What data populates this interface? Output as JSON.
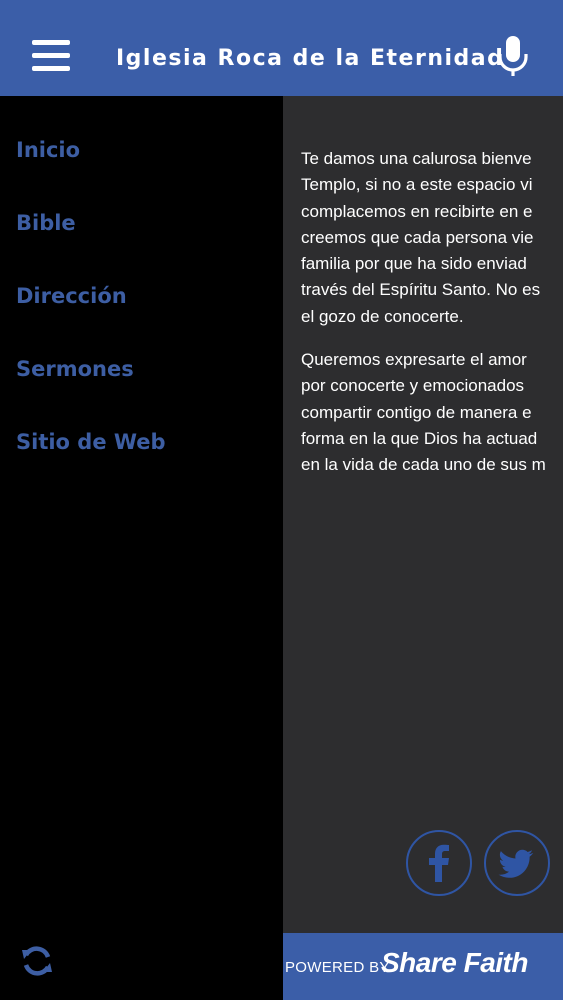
{
  "header": {
    "title": "Iglesia Roca de la Eternidad",
    "menu_icon": "hamburger-menu-icon",
    "mic_icon": "microphone-icon"
  },
  "sidebar": {
    "items": [
      {
        "label": "Inicio"
      },
      {
        "label": "Bible"
      },
      {
        "label": "Dirección"
      },
      {
        "label": "Sermones"
      },
      {
        "label": "Sitio de Web"
      }
    ],
    "refresh_icon": "refresh-icon"
  },
  "content": {
    "paragraph1": [
      "Te damos una calurosa bienve",
      "Templo, si no a este espacio vi",
      "complacemos en recibirte en e",
      "creemos que cada persona vie",
      "familia por que ha sido enviad",
      "través del Espíritu Santo. No es",
      "el gozo de conocerte."
    ],
    "paragraph2": [
      "Queremos expresarte el amor",
      "por conocerte y emocionados",
      "compartir contigo de manera e",
      "forma en la que Dios ha actuad",
      "en la vida de cada uno de sus m"
    ]
  },
  "social": {
    "facebook_icon": "facebook-icon",
    "twitter_icon": "twitter-icon"
  },
  "footer": {
    "powered_by": "POWERED BY",
    "brand": "Share Faith"
  },
  "colors": {
    "header_bg": "#3b5ea8",
    "accent": "#3d5ea3",
    "content_bg": "#2d2d2f",
    "drawer_bg": "#000000"
  }
}
